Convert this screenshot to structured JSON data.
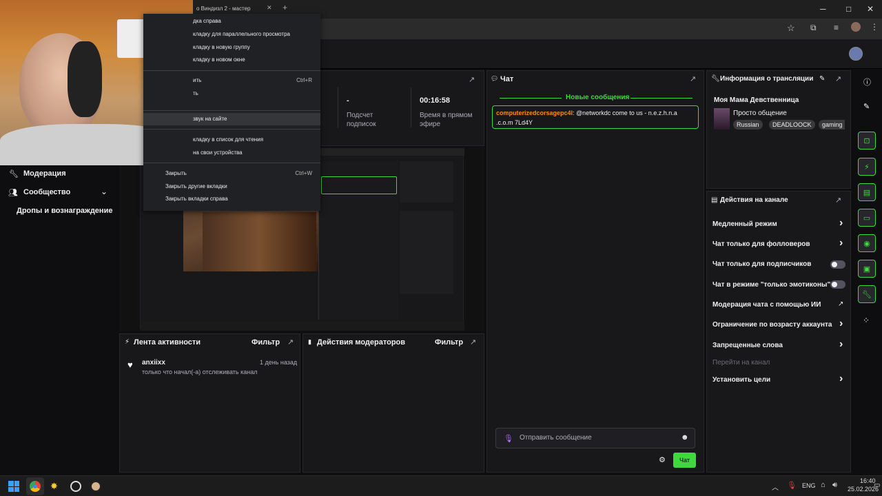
{
  "browser": {
    "tab_title": "о Виндизл 2 - мастер",
    "win_min": "─",
    "win_max": "□",
    "win_close": "✕"
  },
  "context_menu": {
    "items": [
      {
        "label": "дка справа",
        "key": ""
      },
      {
        "label": "кладку для параллельного просмотра",
        "key": ""
      },
      {
        "label": "кладку в новую группу",
        "key": ""
      },
      {
        "label": "кладку в новом окне",
        "key": ""
      },
      {
        "label": "ить",
        "key": "Ctrl+R"
      },
      {
        "label": "ть",
        "key": ""
      },
      {
        "label": "звук на сайте",
        "key": ""
      },
      {
        "label": "кладку в список для чтения",
        "key": ""
      },
      {
        "label": "на свои устройства",
        "key": ""
      },
      {
        "label": "Закрыть",
        "key": "Ctrl+W"
      },
      {
        "label": "Закрыть другие вкладки",
        "key": ""
      },
      {
        "label": "Закрыть вкладки справа",
        "key": ""
      }
    ]
  },
  "sidebar": {
    "moderation": "Модерация",
    "community": "Сообщество",
    "drops": "Дропы и вознаграждение"
  },
  "stats": {
    "subs_value": "-",
    "subs_label": "Подсчет подписок",
    "time_value": "00:16:58",
    "time_label": "Время в прямом эфире"
  },
  "activity": {
    "title": "Лента активности",
    "filter": "Фильтр",
    "item_user": "anxiixx",
    "item_time": "1 день назад",
    "item_text": "только что начал(-а) отслеживать канал"
  },
  "modactions": {
    "title": "Действия модераторов",
    "filter": "Фильтр"
  },
  "chat": {
    "title": "Чат",
    "new_messages": "Новые сообщения",
    "msg_user": "computerizedcorsagepc4l",
    "msg_text": ": @networkdc come to us - n.e.z.h.n.a .c.o.m 7Ld4Y",
    "input_placeholder": "Отправить сообщение",
    "send_button": "Чат"
  },
  "stream_info": {
    "title": "Информация о трансляции",
    "stream_title": "Моя Мама Девственница",
    "category": "Просто общение",
    "tags": [
      "Russian",
      "DEADLOOCK",
      "gaming"
    ]
  },
  "channel_actions": {
    "title": "Действия на канале",
    "items": [
      {
        "label": "Медленный режим",
        "control": "arrow"
      },
      {
        "label": "Чат только для фолловеров",
        "control": "arrow"
      },
      {
        "label": "Чат только для подписчиков",
        "control": "toggle"
      },
      {
        "label": "Чат в режиме \"только эмотиконы\"",
        "control": "toggle"
      },
      {
        "label": "Модерация чата с помощью ИИ",
        "control": "external"
      },
      {
        "label": "Ограничение по возрасту аккаунта",
        "control": "arrow"
      },
      {
        "label": "Запрещенные слова",
        "control": "arrow"
      },
      {
        "label": "Перейти на канал",
        "control": "none"
      },
      {
        "label": "Установить цели",
        "control": "arrow"
      }
    ]
  },
  "taskbar": {
    "lang": "ENG",
    "time": "16:40",
    "date": "25.02.2026"
  },
  "colors": {
    "accent": "#3fd83f",
    "username": "#ff8c00",
    "bg": "#0e0e10",
    "panel": "#18181b"
  }
}
